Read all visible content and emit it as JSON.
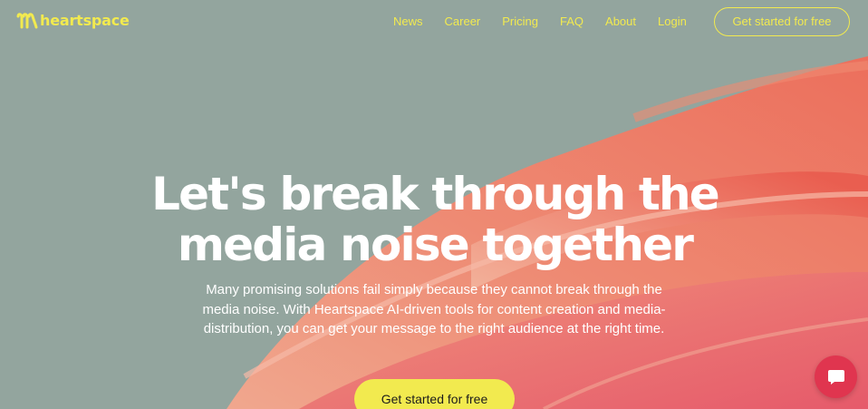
{
  "colors": {
    "accent": "#f2ea4f",
    "background": "#93a59e",
    "chat_widget": "#e0354f"
  },
  "brand": {
    "name": "heartspace",
    "logo_icon": "heartspace-logo-icon"
  },
  "nav": {
    "items": [
      {
        "label": "News"
      },
      {
        "label": "Career"
      },
      {
        "label": "Pricing"
      },
      {
        "label": "FAQ"
      },
      {
        "label": "About"
      },
      {
        "label": "Login"
      }
    ],
    "cta_label": "Get started for free"
  },
  "hero": {
    "title_line1": "Let's break through the",
    "title_line2": "media noise together",
    "subtitle": "Many promising solutions fail simply because they cannot break through the media noise. With Heartspace AI-driven tools for content creation and media-distribution, you can get your message to the right audience at the right time.",
    "cta_label": "Get started for free"
  },
  "chat_widget": {
    "icon": "chat-icon"
  }
}
